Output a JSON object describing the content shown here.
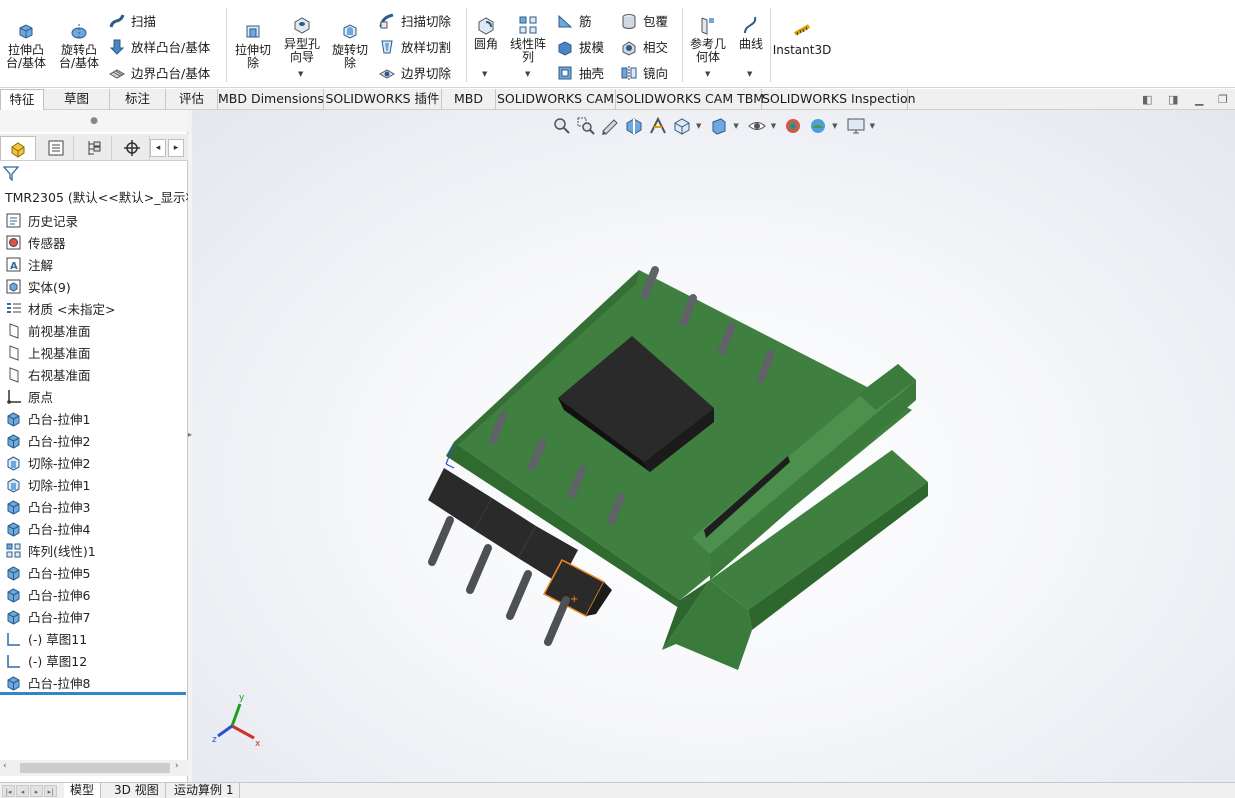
{
  "ribbon": {
    "extrude_boss": "拉伸凸\n台/基体",
    "revolve_boss": "旋转凸\n台/基体",
    "sweep": "扫描",
    "loft_boss": "放样凸台/基体",
    "boundary_boss": "边界凸台/基体",
    "extrude_cut": "拉伸切\n除",
    "hole_wizard": "异型孔\n向导",
    "revolve_cut": "旋转切\n除",
    "sweep_cut": "扫描切除",
    "loft_cut": "放样切割",
    "boundary_cut": "边界切除",
    "fillet": "圆角",
    "linear_pattern": "线性阵\n列",
    "rib": "筋",
    "draft": "拔模",
    "shell": "抽壳",
    "wrap": "包覆",
    "intersect": "相交",
    "mirror": "镜向",
    "ref_geometry": "参考几\n何体",
    "curves": "曲线",
    "instant3d": "Instant3D"
  },
  "tabs": [
    "特征",
    "草图",
    "标注",
    "评估",
    "MBD Dimensions",
    "SOLIDWORKS 插件",
    "MBD",
    "SOLIDWORKS CAM",
    "SOLIDWORKS CAM TBM",
    "SOLIDWORKS Inspection"
  ],
  "tree": {
    "root": "TMR2305  (默认<<默认>_显示状",
    "items": [
      {
        "label": "历史记录",
        "icon": "history-icon"
      },
      {
        "label": "传感器",
        "icon": "sensor-icon"
      },
      {
        "label": "注解",
        "icon": "annotation-icon"
      },
      {
        "label": "实体(9)",
        "icon": "solid-bodies-icon"
      },
      {
        "label": "材质 <未指定>",
        "icon": "material-icon"
      },
      {
        "label": "前视基准面",
        "icon": "plane-icon"
      },
      {
        "label": "上视基准面",
        "icon": "plane-icon"
      },
      {
        "label": "右视基准面",
        "icon": "plane-icon"
      },
      {
        "label": "原点",
        "icon": "origin-icon"
      },
      {
        "label": "凸台-拉伸1",
        "icon": "extrude-boss-icon"
      },
      {
        "label": "凸台-拉伸2",
        "icon": "extrude-boss-icon"
      },
      {
        "label": "切除-拉伸2",
        "icon": "extrude-cut-icon"
      },
      {
        "label": "切除-拉伸1",
        "icon": "extrude-cut-icon"
      },
      {
        "label": "凸台-拉伸3",
        "icon": "extrude-boss-icon"
      },
      {
        "label": "凸台-拉伸4",
        "icon": "extrude-boss-icon"
      },
      {
        "label": "阵列(线性)1",
        "icon": "linear-pattern-icon"
      },
      {
        "label": "凸台-拉伸5",
        "icon": "extrude-boss-icon"
      },
      {
        "label": "凸台-拉伸6",
        "icon": "extrude-boss-icon"
      },
      {
        "label": "凸台-拉伸7",
        "icon": "extrude-boss-icon"
      },
      {
        "label": "(-) 草图11",
        "icon": "sketch-icon"
      },
      {
        "label": "(-) 草图12",
        "icon": "sketch-icon"
      },
      {
        "label": "凸台-拉伸8",
        "icon": "extrude-boss-icon"
      }
    ]
  },
  "bottom_tabs": [
    "模型",
    "3D 视图",
    "运动算例 1"
  ],
  "triad": {
    "x": "x",
    "y": "y",
    "z": "z"
  },
  "colors": {
    "pcb_green": "#3f7f3f",
    "pin_gray": "#5f6266",
    "body_black": "#2a2a2a",
    "selection_orange": "#f08c1e",
    "tree_accent": "#2f86c9"
  }
}
